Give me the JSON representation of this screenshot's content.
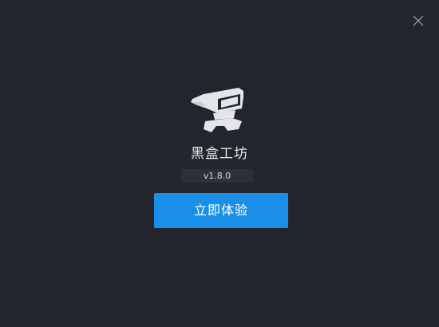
{
  "window": {
    "close_icon": "close-icon"
  },
  "app": {
    "logo_icon": "anvil-icon",
    "name": "黑盒工坊",
    "version": "v1.8.0"
  },
  "actions": {
    "start_label": "立即体验"
  },
  "colors": {
    "background": "#22252c",
    "badge_background": "#2d3038",
    "accent": "#1a8fe8"
  }
}
